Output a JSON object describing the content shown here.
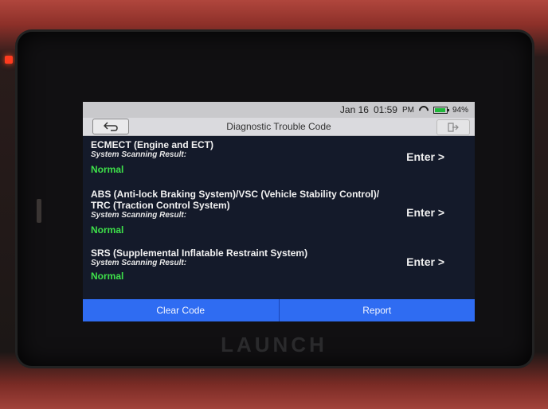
{
  "status": {
    "date": "Jan 16",
    "time": "01:59",
    "ampm": "PM",
    "battery": "94%"
  },
  "header": {
    "title": "Diagnostic Trouble Code",
    "back_icon": "back-arrow-icon",
    "exit_icon": "exit-icon"
  },
  "systems": [
    {
      "name": "ECMECT (Engine and ECT)",
      "scan_label": "System Scanning Result:",
      "result": "Normal",
      "enter_label": "Enter >"
    },
    {
      "name": "ABS (Anti-lock Braking System)/VSC (Vehicle Stability Control)/",
      "name2": "TRC (Traction Control System)",
      "scan_label": "System Scanning Result:",
      "result": "Normal",
      "enter_label": "Enter >"
    },
    {
      "name": "SRS (Supplemental Inflatable Restraint System)",
      "scan_label": "System Scanning Result:",
      "result": "Normal",
      "enter_label": "Enter >"
    }
  ],
  "footer": {
    "clear_label": "Clear Code",
    "report_label": "Report"
  },
  "device": {
    "brand": "LAUNCH"
  },
  "colors": {
    "accent": "#2f6cf2",
    "normal": "#3ee04a"
  }
}
